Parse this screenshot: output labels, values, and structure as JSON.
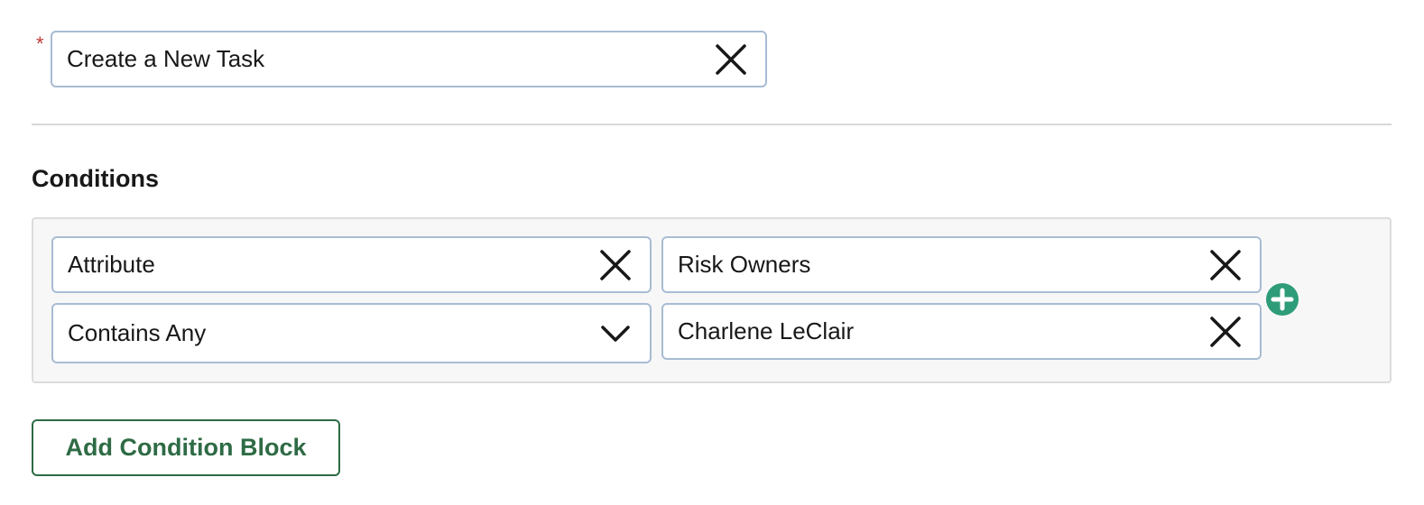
{
  "task": {
    "required_marker": "*",
    "value": "Create a New Task",
    "clear_icon": "close-icon"
  },
  "conditions": {
    "title": "Conditions",
    "rows": [
      {
        "left": {
          "value": "Attribute",
          "icon": "close-icon"
        },
        "right": {
          "value": "Risk Owners",
          "icon": "close-icon"
        }
      },
      {
        "left": {
          "value": "Contains Any",
          "icon": "chevron-down-icon"
        },
        "right": {
          "value": "Charlene LeClair",
          "icon": "close-icon"
        }
      }
    ],
    "add_row_icon": "plus-circle-icon",
    "add_row_icon_color": "#2e9c78"
  },
  "actions": {
    "add_condition_block_label": "Add Condition Block"
  },
  "colors": {
    "required": "#c23934",
    "field_border": "#a8bcd3",
    "panel_background": "#f7f7f8",
    "button_accent": "#2e6b45"
  }
}
